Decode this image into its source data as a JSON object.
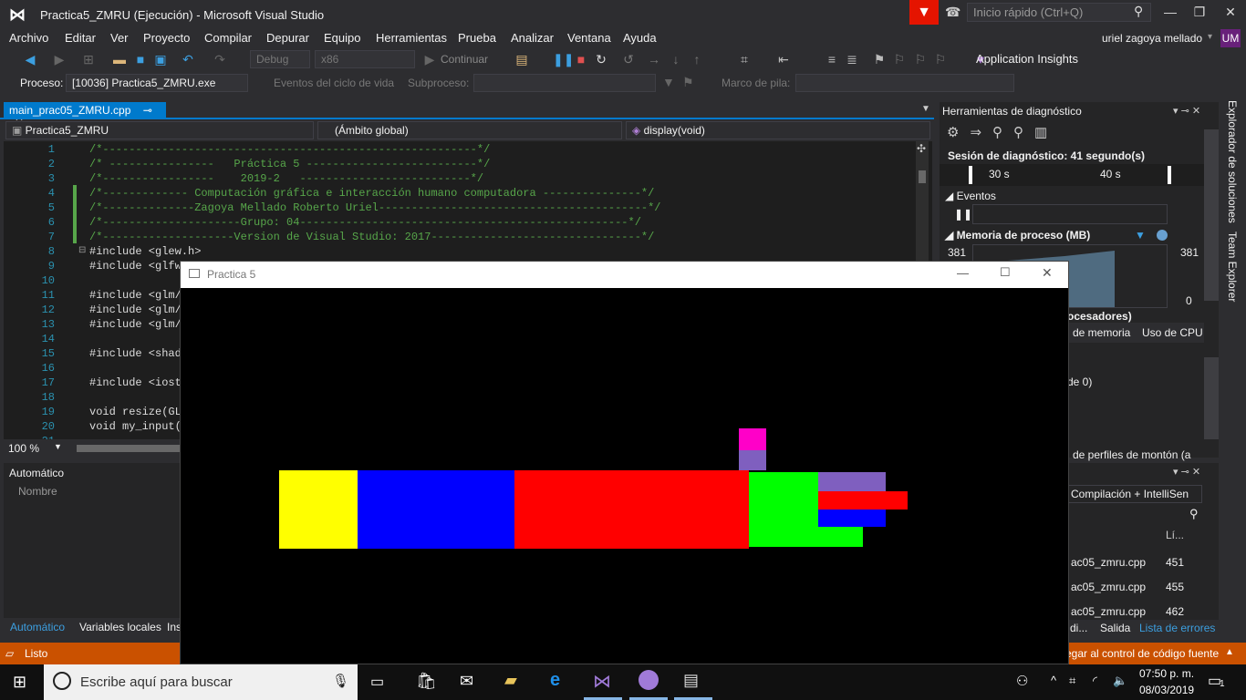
{
  "titlebar": {
    "title": "Practica5_ZMRU (Ejecución) - Microsoft Visual Studio",
    "quick_launch": "Inicio rápido (Ctrl+Q)"
  },
  "menu": [
    "Archivo",
    "Editar",
    "Ver",
    "Proyecto",
    "Compilar",
    "Depurar",
    "Equipo",
    "Herramientas",
    "Prueba",
    "Analizar",
    "Ventana",
    "Ayuda"
  ],
  "user": {
    "name": "uriel zagoya mellado",
    "initials": "UM"
  },
  "toolbar": {
    "config": "Debug",
    "platform": "x86",
    "continue": "Continuar",
    "app_insights": "Application Insights"
  },
  "process_bar": {
    "process_label": "Proceso:",
    "process_value": "[10036] Practica5_ZMRU.exe",
    "lifecycle": "Eventos del ciclo de vida",
    "thread_label": "Subproceso:",
    "stack_label": "Marco de pila:"
  },
  "editor": {
    "tab": "main_prac05_ZMRU.cpp",
    "nav_project": "Practica5_ZMRU",
    "nav_scope": "(Ámbito global)",
    "nav_function": "display(void)",
    "zoom": "100 %",
    "lines": [
      {
        "n": "1",
        "text": "/*---------------------------------------------------------*/",
        "cls": "cmt"
      },
      {
        "n": "2",
        "text": "/* ----------------   Práctica 5 --------------------------*/",
        "cls": "cmt"
      },
      {
        "n": "3",
        "text": "/*-----------------    2019-2   --------------------------*/",
        "cls": "cmt"
      },
      {
        "n": "4",
        "text": "/*------------- Computación gráfica e interacción humano computadora ---------------*/",
        "cls": "cmt"
      },
      {
        "n": "5",
        "text": "/*--------------Zagoya Mellado Roberto Uriel-----------------------------------------*/",
        "cls": "cmt"
      },
      {
        "n": "6",
        "text": "/*---------------------Grupo: 04--------------------------------------------------*/",
        "cls": "cmt"
      },
      {
        "n": "7",
        "text": "/*--------------------Version de Visual Studio: 2017--------------------------------*/",
        "cls": "cmt"
      },
      {
        "n": "8",
        "text": "#include <glew.h>",
        "cls": ""
      },
      {
        "n": "9",
        "text": "#include <glfw",
        "cls": ""
      },
      {
        "n": "10",
        "text": "",
        "cls": ""
      },
      {
        "n": "11",
        "text": "#include <glm/",
        "cls": ""
      },
      {
        "n": "12",
        "text": "#include <glm/",
        "cls": ""
      },
      {
        "n": "13",
        "text": "#include <glm/",
        "cls": ""
      },
      {
        "n": "14",
        "text": "",
        "cls": ""
      },
      {
        "n": "15",
        "text": "#include <shad",
        "cls": ""
      },
      {
        "n": "16",
        "text": "",
        "cls": ""
      },
      {
        "n": "17",
        "text": "#include <iost",
        "cls": ""
      },
      {
        "n": "18",
        "text": "",
        "cls": ""
      },
      {
        "n": "19",
        "text": "void resize(GL",
        "cls": ""
      },
      {
        "n": "20",
        "text": "void my_input(",
        "cls": ""
      },
      {
        "n": "21",
        "text": "",
        "cls": ""
      }
    ]
  },
  "auto_panel": {
    "title": "Automático",
    "column": "Nombre",
    "tabs": [
      "Automático",
      "Variables locales",
      "Ins"
    ]
  },
  "diagnostics": {
    "title": "Herramientas de diagnóstico",
    "session": "Sesión de diagnóstico: 41 segundo(s)",
    "t1": "30 s",
    "t2": "40 s",
    "events": "Eventos",
    "memory": "Memoria de proceso (MB)",
    "mem_left": "381",
    "mem_left2": "0",
    "mem_right": "381",
    "mem_right2": "0",
    "processors": "ocesadores)",
    "tab_mem": "de memoria",
    "tab_cpu": "Uso de CPU",
    "row1": "de 0)",
    "row2": "de perfiles de montón (a"
  },
  "errors": {
    "filter": "Compilación + IntelliSen",
    "col_line": "Lí...",
    "rows": [
      {
        "file": "ac05_zmru.cpp",
        "line": "451"
      },
      {
        "file": "ac05_zmru.cpp",
        "line": "455"
      },
      {
        "file": "ac05_zmru.cpp",
        "line": "462"
      }
    ],
    "tabs": [
      "di...",
      "Salida",
      "Lista de errores"
    ]
  },
  "side_tabs": [
    "Explorador de soluciones",
    "Team Explorer"
  ],
  "status": {
    "ready": "Listo",
    "source_control": "egar al control de código fuente"
  },
  "gl_window": {
    "title": "Practica 5"
  },
  "taskbar": {
    "search": "Escribe aquí para buscar",
    "time": "07:50 p. m.",
    "date": "08/03/2019",
    "notifications": "1"
  },
  "colors": {
    "yellow": "#ffff00",
    "blue": "#0000ff",
    "red": "#ff0000",
    "green": "#00ff00",
    "magenta": "#ff00c8",
    "purple": "#7f5fbf",
    "accent": "#007acc",
    "status": "#ca5100"
  }
}
